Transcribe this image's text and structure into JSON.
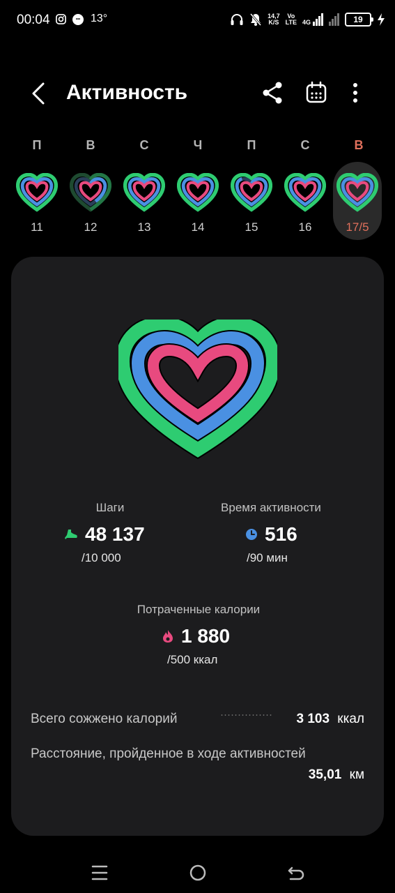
{
  "status_bar": {
    "time": "00:04",
    "temperature": "13°",
    "network_speed_value": "14,7",
    "network_speed_unit": "K/S",
    "volte_top": "Vo",
    "volte_bottom": "LTE",
    "network_type": "4G",
    "battery": "19",
    "icons": [
      "instagram-icon",
      "notification-dot-icon",
      "headphones-icon",
      "mute-icon",
      "signal-icon",
      "battery-icon",
      "charging-icon"
    ]
  },
  "header": {
    "title": "Активность",
    "icons": [
      "back-arrow-icon",
      "share-icon",
      "calendar-icon",
      "more-vertical-icon"
    ]
  },
  "week": [
    {
      "letter": "П",
      "number": "11",
      "selected": false
    },
    {
      "letter": "В",
      "number": "12",
      "selected": false
    },
    {
      "letter": "С",
      "number": "13",
      "selected": false
    },
    {
      "letter": "Ч",
      "number": "14",
      "selected": false
    },
    {
      "letter": "П",
      "number": "15",
      "selected": false
    },
    {
      "letter": "С",
      "number": "16",
      "selected": false
    },
    {
      "letter": "В",
      "number": "17/5",
      "selected": true
    }
  ],
  "stats": {
    "steps": {
      "label": "Шаги",
      "value": "48 137",
      "goal": "/10 000",
      "icon": "shoe-icon",
      "color": "#2ecc71"
    },
    "active_time": {
      "label": "Время активности",
      "value": "516",
      "goal": "/90 мин",
      "icon": "clock-icon",
      "color": "#4a90e2"
    },
    "calories": {
      "label": "Потраченные калории",
      "value": "1 880",
      "goal": "/500 ккал",
      "icon": "flame-icon",
      "color": "#e84a7f"
    }
  },
  "summary": {
    "total_calories_label": "Всего сожжено калорий",
    "total_calories_value": "3 103",
    "total_calories_unit": "ккал",
    "distance_label": "Расстояние, пройденное в ходе активностей",
    "distance_value": "35,01",
    "distance_unit": "км"
  },
  "colors": {
    "ring_outer": "#2ecc71",
    "ring_middle": "#4a90e2",
    "ring_inner": "#e84a7f",
    "selected_day": "#e0705c",
    "card_bg": "#1c1c1e"
  },
  "navbar": {
    "icons": [
      "recent-apps-icon",
      "home-icon",
      "back-icon"
    ]
  }
}
